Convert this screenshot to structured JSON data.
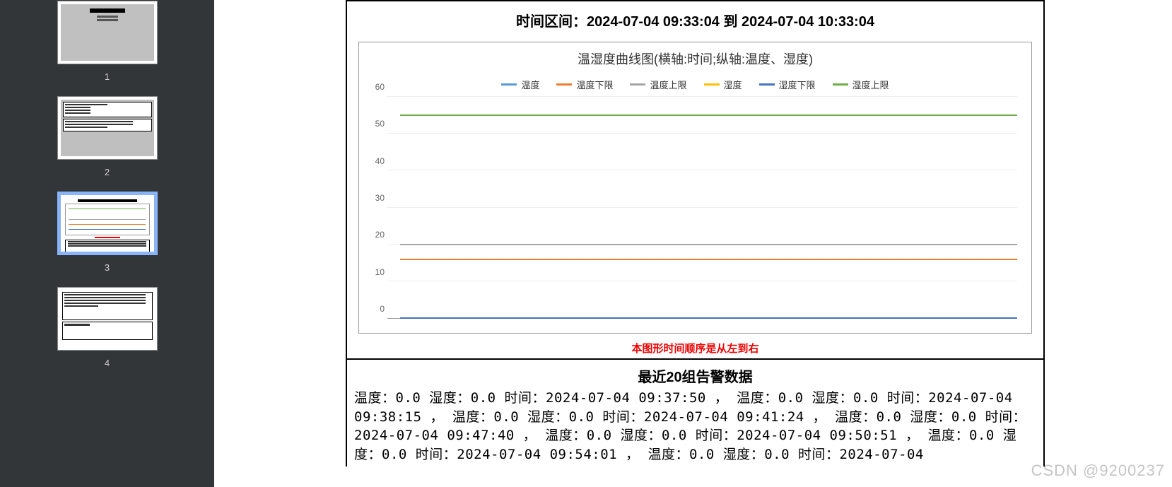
{
  "sidebar": {
    "thumbs": [
      "1",
      "2",
      "3",
      "4"
    ],
    "selected": 3
  },
  "page": {
    "time_range_heading": "时间区间：2024-07-04 09:33:04 到 2024-07-04 10:33:04",
    "chart_note": "本图形时间顺序是从左到右",
    "alert_heading": "最近20组告警数据",
    "alert_body": "温度：0.0 湿度：0.0 时间：2024-07-04 09:37:50 ， 温度：0.0 湿度：0.0 时间：2024-07-04 09:38:15 ， 温度：0.0 湿度：0.0 时间：2024-07-04 09:41:24 ， 温度：0.0 湿度：0.0 时间：2024-07-04 09:47:40 ， 温度：0.0 湿度：0.0 时间：2024-07-04 09:50:51 ， 温度：0.0 湿度：0.0 时间：2024-07-04 09:54:01 ， 温度：0.0 湿度：0.0 时间：2024-07-04"
  },
  "chart_data": {
    "type": "line",
    "title": "温湿度曲线图(横轴:时间;纵轴:温度、湿度)",
    "xlabel": "",
    "ylabel": "",
    "ylim": [
      0,
      60
    ],
    "y_ticks": [
      0,
      10,
      20,
      30,
      40,
      50,
      60
    ],
    "x_range": [
      "2024-07-04 09:33:04",
      "2024-07-04 10:33:04"
    ],
    "series": [
      {
        "name": "温度",
        "color": "#5b9bd5",
        "values": [
          0,
          0
        ]
      },
      {
        "name": "温度下限",
        "color": "#ed7d31",
        "values": [
          16,
          16
        ]
      },
      {
        "name": "温度上限",
        "color": "#a5a5a5",
        "values": [
          20,
          20
        ]
      },
      {
        "name": "湿度",
        "color": "#ffc000",
        "values": [
          0,
          0
        ]
      },
      {
        "name": "湿度下限",
        "color": "#4472c4",
        "values": [
          0,
          0
        ]
      },
      {
        "name": "湿度上限",
        "color": "#70ad47",
        "values": [
          55,
          55
        ]
      }
    ]
  },
  "watermark": "CSDN @9200237"
}
